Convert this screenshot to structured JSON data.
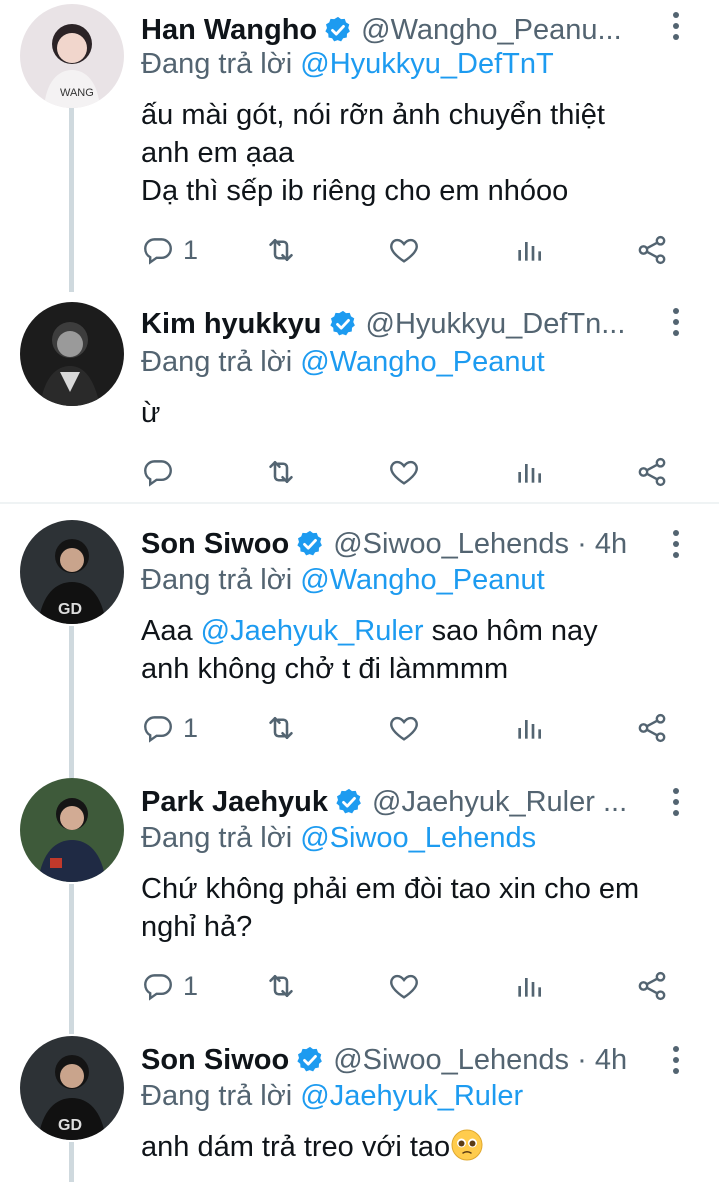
{
  "tweets": [
    {
      "name": "Han Wangho",
      "handle": "@Wangho_Peanu...",
      "reply_prefix": "Đang trả lời",
      "reply_to": "@Hyukkyu_DefTnT",
      "lines": [
        "ấu mài gót, nói rỡn ảnh chuyển thiệt",
        "anh em ạaa",
        "Dạ thì sếp ib riêng cho em nhóoo"
      ],
      "reply_count": "1"
    },
    {
      "name": "Kim hyukkyu",
      "handle": "@Hyukkyu_DefTn...",
      "reply_prefix": "Đang trả lời",
      "reply_to": "@Wangho_Peanut",
      "lines": [
        "ừ"
      ],
      "reply_count": ""
    },
    {
      "name": "Son Siwoo",
      "handle": "@Siwoo_Lehends · 4h",
      "reply_prefix": "Đang trả lời",
      "reply_to": "@Wangho_Peanut",
      "line1_pre": "Aaa ",
      "line1_mention": "@Jaehyuk_Ruler",
      "line1_post": " sao hôm nay",
      "line2": "anh không chở t đi làmmmm",
      "reply_count": "1"
    },
    {
      "name": "Park Jaehyuk",
      "handle": "@Jaehyuk_Ruler ...",
      "reply_prefix": "Đang trả lời",
      "reply_to": "@Siwoo_Lehends",
      "lines": [
        "Chứ không phải em đòi tao xin cho em",
        "nghỉ hả?"
      ],
      "reply_count": "1"
    },
    {
      "name": "Son Siwoo",
      "handle": "@Siwoo_Lehends · 4h",
      "reply_prefix": "Đang trả lời",
      "reply_to": "@Jaehyuk_Ruler",
      "text": "anh dám trả treo với tao",
      "emoji": "pleading-face"
    }
  ],
  "colors": {
    "accent": "#1d9bf0",
    "muted": "#536471",
    "text": "#0f1419",
    "line": "#cfd9de"
  },
  "icons": [
    "reply-icon",
    "retweet-icon",
    "like-icon",
    "analytics-icon",
    "share-icon",
    "more-icon",
    "verified-badge-icon"
  ]
}
